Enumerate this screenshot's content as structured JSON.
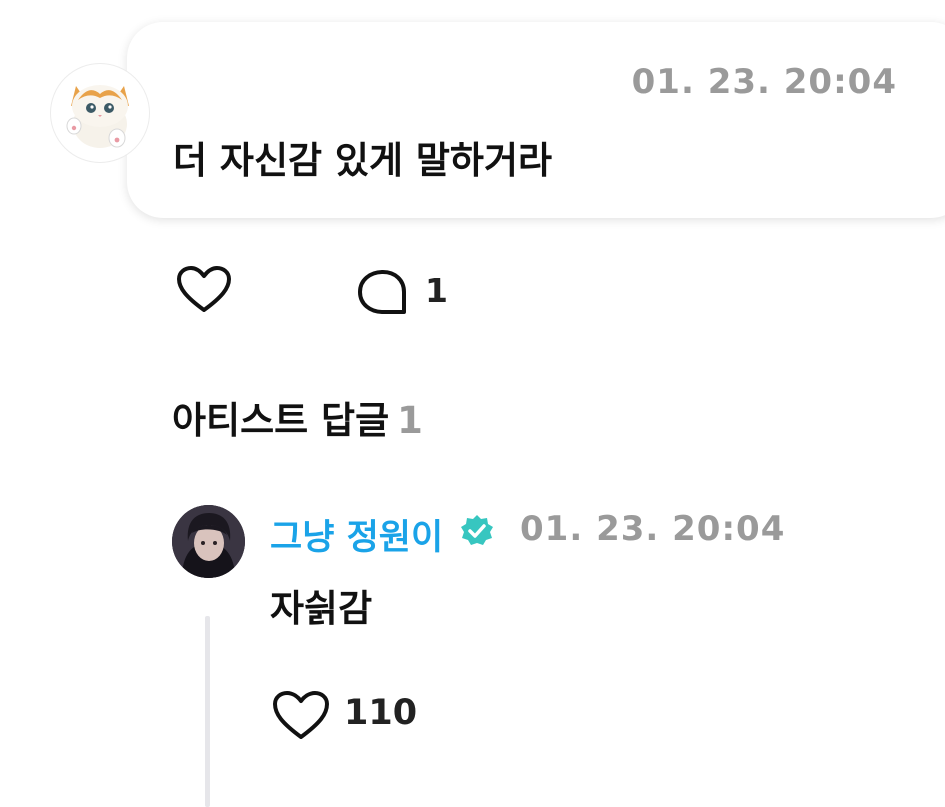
{
  "comment": {
    "timestamp": "01. 23. 20:04",
    "text": "더 자신감 있게 말하거라",
    "avatar_icon": "cat-avatar",
    "like_icon": "heart-outline-icon",
    "reply_icon": "speech-bubble-icon",
    "reply_count": "1"
  },
  "artist_replies": {
    "title": "아티스트 답글",
    "count": "1",
    "items": [
      {
        "author": "그냥 정원이",
        "verified_icon": "verified-badge-icon",
        "timestamp": "01. 23. 20:04",
        "text": "자싉감",
        "like_icon": "heart-outline-icon",
        "like_count": "110"
      }
    ]
  },
  "colors": {
    "author_name": "#1aa3e8",
    "verified_badge": "#37c6c0",
    "muted_text": "#9a9a9a",
    "thread_line": "#e6e6ea"
  }
}
